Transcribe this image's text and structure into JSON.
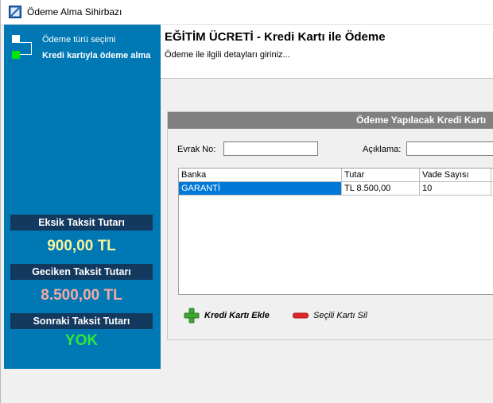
{
  "window": {
    "title": "Ödeme Alma Sihirbazı"
  },
  "sidebar": {
    "steps": [
      {
        "label": "Ödeme türü seçimi",
        "active": false
      },
      {
        "label": "Kredi kartıyla ödeme alma",
        "active": true
      }
    ],
    "info": [
      {
        "label": "Eksik Taksit Tutarı",
        "value": "900,00 TL",
        "color": "#f6f39a"
      },
      {
        "label": "Geciken Taksit Tutarı",
        "value": "8.500,00 TL",
        "color": "#f4a9a0"
      },
      {
        "label": "Sonraki Taksit Tutarı",
        "value": "YOK",
        "color": "#2de83a"
      }
    ]
  },
  "header": {
    "title": "EĞİTİM ÜCRETİ - Kredi Kartı ile Ödeme",
    "subtitle": "Ödeme ile ilgili detayları giriniz..."
  },
  "panel": {
    "title": "Ödeme Yapılacak Kredi Kartı",
    "evrak_label": "Evrak No:",
    "evrak_value": "",
    "aciklama_label": "Açıklama:",
    "aciklama_value": "",
    "grid": {
      "columns": [
        "Banka",
        "Tutar",
        "Vade Sayısı"
      ],
      "rows": [
        [
          "GARANTİ",
          "TL 8.500,00",
          "10"
        ]
      ]
    },
    "add_button": "Kredi Kartı Ekle",
    "delete_button": "Seçili Kartı Sil"
  }
}
